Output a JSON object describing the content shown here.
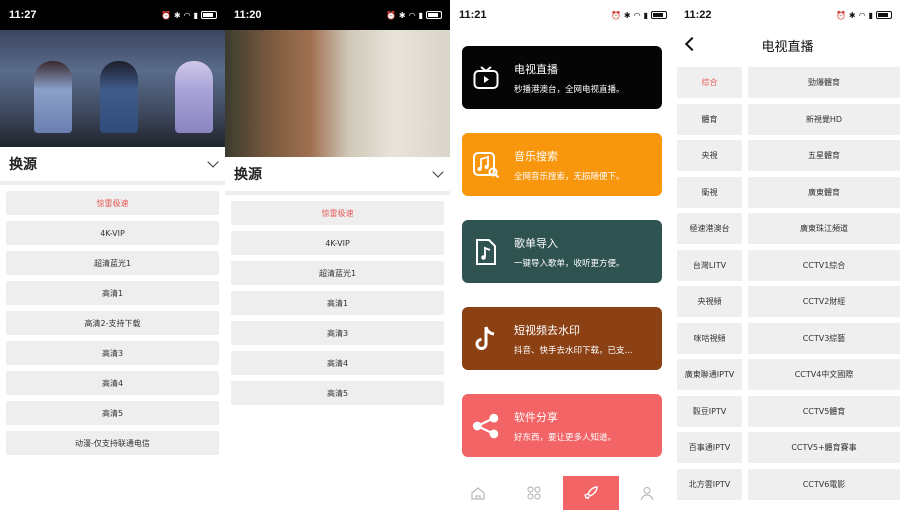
{
  "screen1": {
    "time": "11:27",
    "video_caption": "",
    "source_header": "换源",
    "sources": [
      "惊雷极速",
      "4K-VIP",
      "超清蓝光1",
      "高清1",
      "高清2-支持下载",
      "高清3",
      "高清4",
      "高清5",
      "动漫-仅支持联通电信"
    ],
    "active_index": 0
  },
  "screen2": {
    "time": "11:20",
    "source_header": "换源",
    "sources": [
      "惊雷极速",
      "4K-VIP",
      "超清蓝光1",
      "高清1",
      "高清3",
      "高清4",
      "高清5"
    ],
    "active_index": 0
  },
  "screen3": {
    "time": "11:21",
    "cards": [
      {
        "title": "电视直播",
        "desc": "秒播港澳台，全网电视直播。",
        "color": "#050505",
        "icon": "tv-icon"
      },
      {
        "title": "音乐搜索",
        "desc": "全网音乐搜索，无损随便下。",
        "color": "#f8960d",
        "icon": "music-search-icon"
      },
      {
        "title": "歌单导入",
        "desc": "一键导入歌单，收听更方便。",
        "color": "#2f5350",
        "icon": "music-file-icon"
      },
      {
        "title": "短视频去水印",
        "desc": "抖音、快手去水印下载，已支...",
        "color": "#8b4114",
        "icon": "tiktok-icon"
      },
      {
        "title": "软件分享",
        "desc": "好东西，要让更多人知道。",
        "color": "#f26466",
        "icon": "share-icon"
      }
    ],
    "tabs": [
      "home-icon",
      "apps-icon",
      "rocket-icon",
      "user-icon"
    ],
    "active_tab": 2
  },
  "screen4": {
    "time": "11:22",
    "title": "电视直播",
    "categories": [
      "综合",
      "體育",
      "央視",
      "衛視",
      "極速港澳台",
      "台灣LITV",
      "央視頻",
      "咪咕視頻",
      "廣東聯通IPTV",
      "穀豆IPTV",
      "百事通IPTV",
      "北方雲IPTV"
    ],
    "channels": [
      "勁爆體育",
      "新視覺HD",
      "五星體育",
      "廣東體育",
      "廣東珠江頻道",
      "CCTV1綜合",
      "CCTV2財經",
      "CCTV3綜藝",
      "CCTV4中文國際",
      "CCTV5體育",
      "CCTV5+體育賽事",
      "CCTV6電影"
    ],
    "active_category": 0
  }
}
